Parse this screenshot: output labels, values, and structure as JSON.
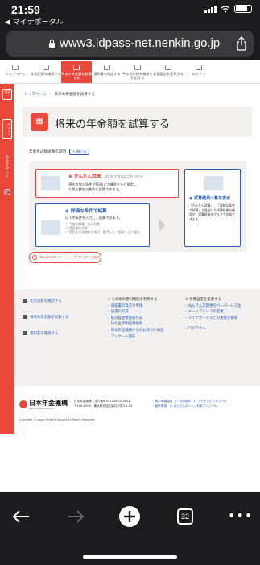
{
  "status": {
    "time": "21:59",
    "back_label": "◀ マイナポータル"
  },
  "browser": {
    "url": "www3.idpass-net.nenkin.go.jp",
    "tab_count": "32"
  },
  "gnav": [
    {
      "label": "トップページ"
    },
    {
      "label": "年金記録を確認する"
    },
    {
      "label": "将来の年金額を試算する"
    },
    {
      "label": "通知書を確認する"
    },
    {
      "label": "その他の便利機能を利用する"
    },
    {
      "label": "各種設定を変更する"
    },
    {
      "label": "ログアウ"
    }
  ],
  "side": {
    "btn1": "目次",
    "btn2": "メニュー",
    "vertical": "ねんきんネット",
    "dot": "?"
  },
  "breadcrumb": {
    "home": "トップページ",
    "current": "将来の年金額を試算する"
  },
  "page_title": "将来の年金額を試算する",
  "explain": {
    "text": "年金見込額試算の説明",
    "button": "開ける"
  },
  "simple_card": {
    "title": "かんたん試算",
    "subtitle": "はじめての方はこちらから",
    "body1": "現在の加入条件が60歳まで継続すると仮定し",
    "body2": "て見込額を自動的に試算できます。"
  },
  "detail_card": {
    "title": "詳細な条件で試算",
    "body": "以下の条件を入力し、試算できます。",
    "notes": [
      "今後の職業、加入月数",
      "受給開始年齢",
      "国民年金保険料を納付・猶予した（追納）した場合"
    ]
  },
  "result_card": {
    "title": "試算結果一覧を表示",
    "body1": "「かんたん試算」、「詳細な条件",
    "body2": "で試算」で登録した試算結果の確",
    "body3": "認や、試算結果をグラフで比較で",
    "body4": "きます。"
  },
  "top_button": "ねんきんネット（トップページ）へ戻る",
  "footer": {
    "col1": [
      "年金記録を確認する",
      "将来の年金額を試算する",
      "通知書を確認する"
    ],
    "col2_head": "その他の便利機能を利用する",
    "col2": [
      "通知書の再交付申請",
      "届書の作成",
      "私の履歴整理表作成",
      "持ち主不明記録検索",
      "日本年金機構からのお知らせ確認",
      "アンケート回答"
    ],
    "col3_head": "各種設定を変更する",
    "col3": [
      "ねんきん定期便のペーパーレス化",
      "メールアドレスの変更",
      "マイナポータルとの連携を解除"
    ],
    "logout": "ログアウト"
  },
  "org": {
    "name": "日本年金機構",
    "sub": "Japan Pension Service",
    "addr1": "日本年金機構　法人番号4011305001653",
    "addr2": "〒168-8505　東京都杉並区高井戸西3-5-24",
    "links1": "› 個人情報保護　| › 利用規約　| › アクセシビリティへの",
    "links2": "› 動作環境　| › ねんきんネット」利用マニュアル",
    "copyright": "Copyright © Japan Pension Service All Rights Reserved."
  }
}
